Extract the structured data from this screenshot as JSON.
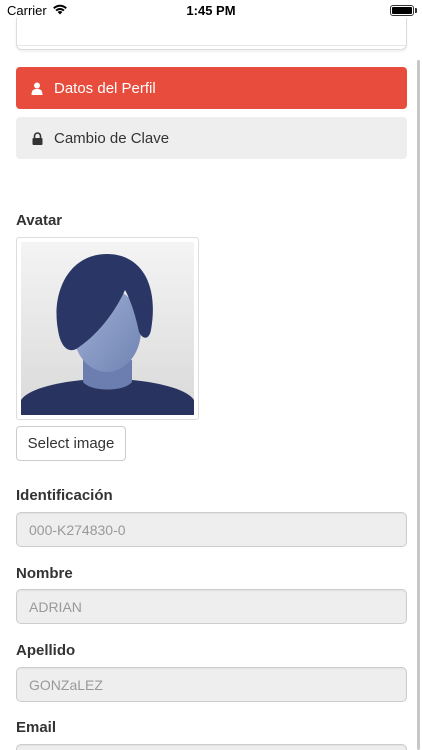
{
  "status_bar": {
    "carrier": "Carrier",
    "time": "1:45 PM"
  },
  "tabs": [
    {
      "label": "Datos del Perfil",
      "icon": "user-icon",
      "active": true
    },
    {
      "label": "Cambio de Clave",
      "icon": "lock-icon",
      "active": false
    }
  ],
  "avatar": {
    "label": "Avatar",
    "select_button": "Select image"
  },
  "fields": [
    {
      "label": "Identificación",
      "value": "000-K274830-0"
    },
    {
      "label": "Nombre",
      "value": "ADRIAN"
    },
    {
      "label": "Apellido",
      "value": "GONZaLEZ"
    },
    {
      "label": "Email",
      "value": ""
    }
  ],
  "colors": {
    "accent": "#e74c3c",
    "tab_inactive": "#eeeeee",
    "input_bg": "#eeeeee"
  }
}
